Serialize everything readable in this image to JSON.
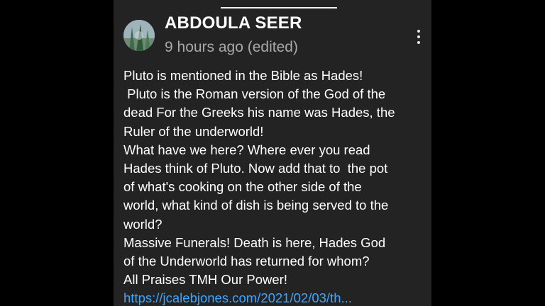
{
  "comment": {
    "author": "ABDOULA SEER",
    "timestamp": "9 hours ago (edited)",
    "body_lines": [
      "Pluto is mentioned in the Bible as Hades!",
      " Pluto is the Roman version of the God of the",
      "dead For the Greeks his name was Hades, the",
      "Ruler of the underworld!",
      "What have we here? Where ever you read",
      "Hades think of Pluto. Now add that to  the pot",
      "of what's cooking on the other side of the",
      "world, what kind of dish is being served to the",
      "world?",
      "Massive Funerals! Death is here, Hades God",
      "of the Underworld has returned for whom?",
      "All Praises TMH Our Power!"
    ],
    "link_text": "https://jcalebjones.com/2021/02/03/th...",
    "more_icon": "vertical-ellipsis-icon",
    "avatar_icon": "profile-photo"
  },
  "colors": {
    "background": "#232323",
    "letterbox": "#000000",
    "name": "#ffffff",
    "timestamp": "#a9a9a9",
    "body": "#ffffff",
    "link": "#3ea6ff"
  }
}
